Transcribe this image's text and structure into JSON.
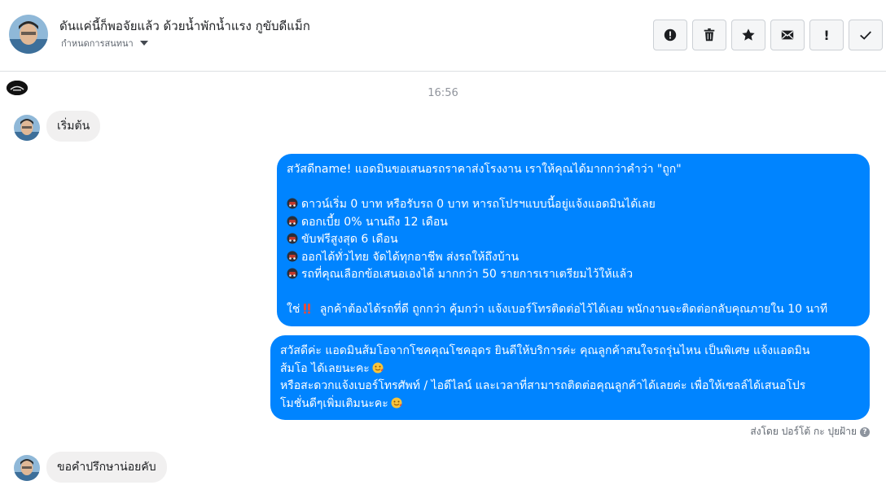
{
  "header": {
    "name": "ดันแค่นี้ก็พอจัยแล้ว ด้วยน้ำพักน้ำแรง กูขับดีแม็ก",
    "subtitle": "กำหนดการสนทนา"
  },
  "actions": [
    {
      "name": "alert-circle-icon",
      "label": ""
    },
    {
      "name": "trash-icon",
      "label": ""
    },
    {
      "name": "star-icon",
      "label": ""
    },
    {
      "name": "mail-icon",
      "label": ""
    },
    {
      "name": "exclamation-icon",
      "label": "!"
    },
    {
      "name": "check-icon",
      "label": ""
    }
  ],
  "conversation": {
    "timestamp": "16:56",
    "messages": [
      {
        "from": "customer",
        "text": "เริ่มต้น"
      },
      {
        "from": "page",
        "lines": [
          "สวัสดีname! แอดมินขอเสนอรถราคาส่งโรงงาน เราให้คุณได้มากกว่าคำว่า \"ถูก\"",
          "",
          "ดาวน์เริ่ม 0 บาท หรือรับรถ 0 บาท หารถโปรฯแบบนี้อยู่แจ้งแอดมินได้เลย",
          "ดอกเบี้ย 0% นานถึง 12 เดือน",
          "ขับฟรีสูงสุด 6 เดือน",
          "ออกได้ทั่วไทย จัดได้ทุกอาชีพ ส่งรถให้ถึงบ้าน",
          "รถที่คุณเลือกข้อเสนอเองได้ มากกว่า 50 รายการเราเตรียมไว้ให้แล้ว",
          "",
          "ใช่ ลูกค้าต้องได้รถที่ดี ถูกกว่า คุ้มกว่า แจ้งเบอร์โทรติดต่อไว้ได้เลย พนักงานจะติดต่อกลับคุณภายใน 10 นาที"
        ]
      },
      {
        "from": "page",
        "lines": [
          "สวัสดีค่ะ แอดมินส้มโอจากโชคคุณโชคอุดร ยินดีให้บริการค่ะ   คุณลูกค้าสนใจรถรุ่นไหน เป็นพิเศษ แจ้งแอดมิน",
          "ส้มโอ ได้เลยนะคะ",
          "หรือสะดวกแจ้งเบอร์โทรศัพท์ / ไอดีไลน์ และเวลาที่สามารถติดต่อคุณลูกค้าได้เลยค่ะ เพื่อให้เซลล์ได้เสนอโปร",
          "โมชั่นดีๆเพิ่มเติมนะคะ"
        ],
        "sent_by": "ส่งโดย ปอร์โต้ กะ ปุยฝ้าย",
        "help_label": "?"
      },
      {
        "from": "customer",
        "text": "ขอคำปรึกษาน่อยคับ"
      }
    ]
  },
  "colors": {
    "bubble_out": "#0084ff",
    "bubble_in": "#f1f0f0",
    "header_border": "#dddfe2"
  }
}
